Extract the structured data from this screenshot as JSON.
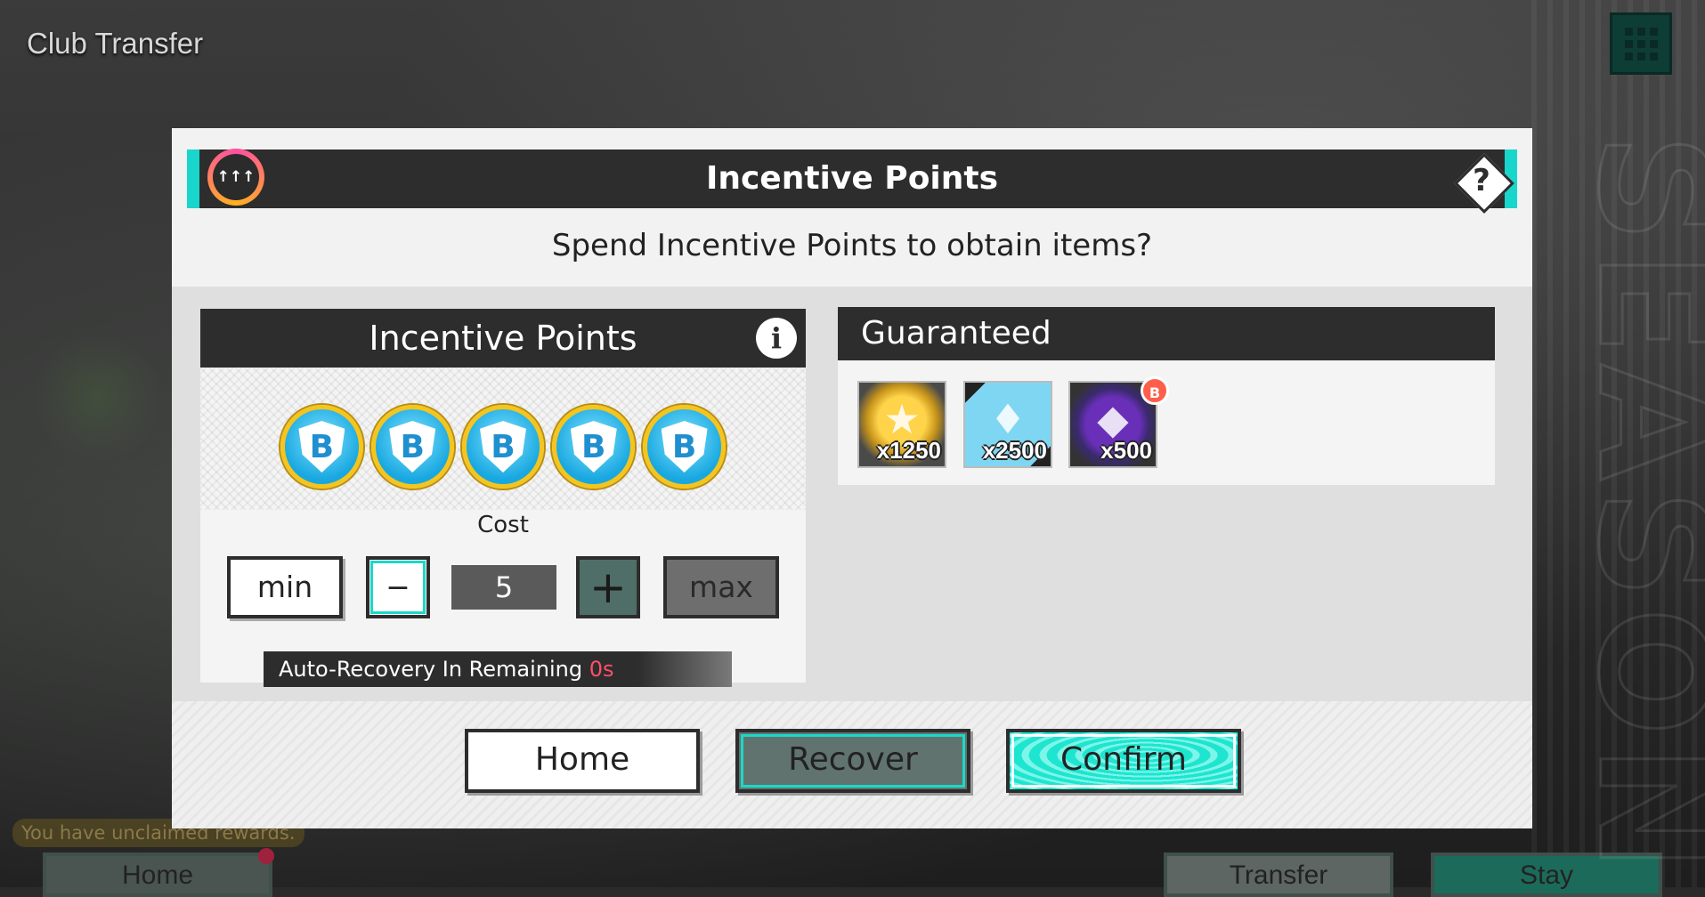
{
  "background": {
    "page_title": "Club Transfer",
    "menu_icon": "grid-icon",
    "unclaimed_text": "You have unclaimed rewards.",
    "buttons": {
      "home": "Home",
      "transfer": "Transfer",
      "stay": "Stay"
    }
  },
  "dialog": {
    "header_icon": "incentive-icon",
    "header_icon_text": "↑↑↑",
    "title": "Incentive Points",
    "help_label": "?",
    "question": "Spend Incentive Points to obtain items?",
    "incentive_panel": {
      "title": "Incentive Points",
      "info_label": "i",
      "coins": [
        "B",
        "B",
        "B",
        "B",
        "B"
      ],
      "cost_label": "Cost",
      "cost_value": "5",
      "min_label": "min",
      "minus_label": "−",
      "plus_label": "+",
      "max_label": "max",
      "recovery_label": "Auto-Recovery In Remaining",
      "recovery_time": "0s"
    },
    "guaranteed_panel": {
      "title": "Guaranteed",
      "items": [
        {
          "icon": "gold-coin-player-icon",
          "count": "x1250"
        },
        {
          "icon": "skill-card-icon",
          "count": "x2500"
        },
        {
          "icon": "shield-badge-icon",
          "count": "x500"
        }
      ],
      "badge_tag": "B"
    },
    "footer": {
      "home_label": "Home",
      "recover_label": "Recover",
      "confirm_label": "Confirm"
    }
  },
  "colors": {
    "accent_cyan": "#19d6cd",
    "header_dark": "#2d2d2d",
    "recovery_time": "#ff4f6a",
    "coin_gold": "#f4c51f",
    "coin_blue": "#18a7e0"
  }
}
